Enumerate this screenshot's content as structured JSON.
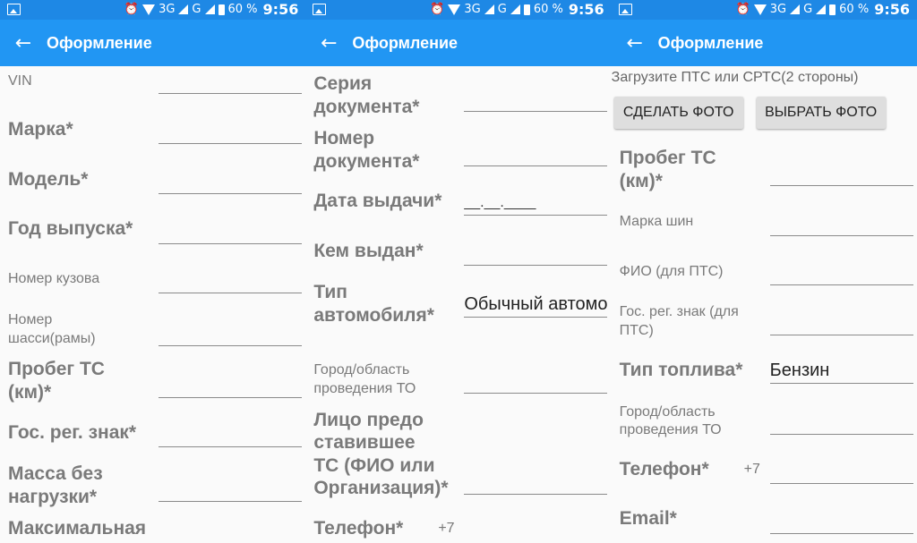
{
  "status": {
    "network": "3G",
    "network2": "G",
    "battery": "60 %",
    "time": "9:56"
  },
  "toolbar": {
    "title": "Оформление",
    "back_glyph": "←"
  },
  "screen1": {
    "vin": "VIN",
    "brand": "Марка*",
    "model": "Модель*",
    "year": "Год выпуска*",
    "body_number": "Номер кузова",
    "chassis_line1": "Номер",
    "chassis_line2": "шасси(рамы)",
    "mileage_line1": "Пробег ТС",
    "mileage_line2": "(км)*",
    "plate": "Гос. рег. знак*",
    "mass_line1": "Масса без",
    "mass_line2": "нагрузки*",
    "max": "Максимальная"
  },
  "screen2": {
    "series_line1": "Серия",
    "series_line2": "документа*",
    "number_line1": "Номер",
    "number_line2": "документа*",
    "issue_date": "Дата выдачи*",
    "issue_date_mask": "__.__.____",
    "issued_by": "Кем выдан*",
    "car_type_line1": "Тип",
    "car_type_line2": "автомобиля*",
    "car_type_value": "Обычный автомобиль",
    "city_line1": "Город/область",
    "city_line2": "проведения ТО",
    "person_line1": "Лицо предо",
    "person_line2": "ставившее",
    "person_line3": "ТС (ФИО или",
    "person_line4": "Организация)*",
    "phone": "Телефон*",
    "phone_prefix": "+7"
  },
  "screen3": {
    "upload_hint": "Загрузите ПТС или СРТС(2 стороны)",
    "take_photo": "СДЕЛАТЬ ФОТО",
    "choose_photo": "ВЫБРАТЬ ФОТО",
    "mileage_line1": "Пробег ТС",
    "mileage_line2": "(км)*",
    "tires": "Марка шин",
    "fio": "ФИО (для ПТС)",
    "plate_line1": "Гос. рег. знак (для",
    "plate_line2": "ПТС)",
    "fuel": "Тип топлива*",
    "fuel_value": "Бензин",
    "city_line1": "Город/область",
    "city_line2": "проведения ТО",
    "phone": "Телефон*",
    "phone_prefix": "+7",
    "email": "Email*"
  },
  "colors": {
    "statusbar": "#1e88e5",
    "toolbar": "#2196f3",
    "background": "#fafafa"
  }
}
